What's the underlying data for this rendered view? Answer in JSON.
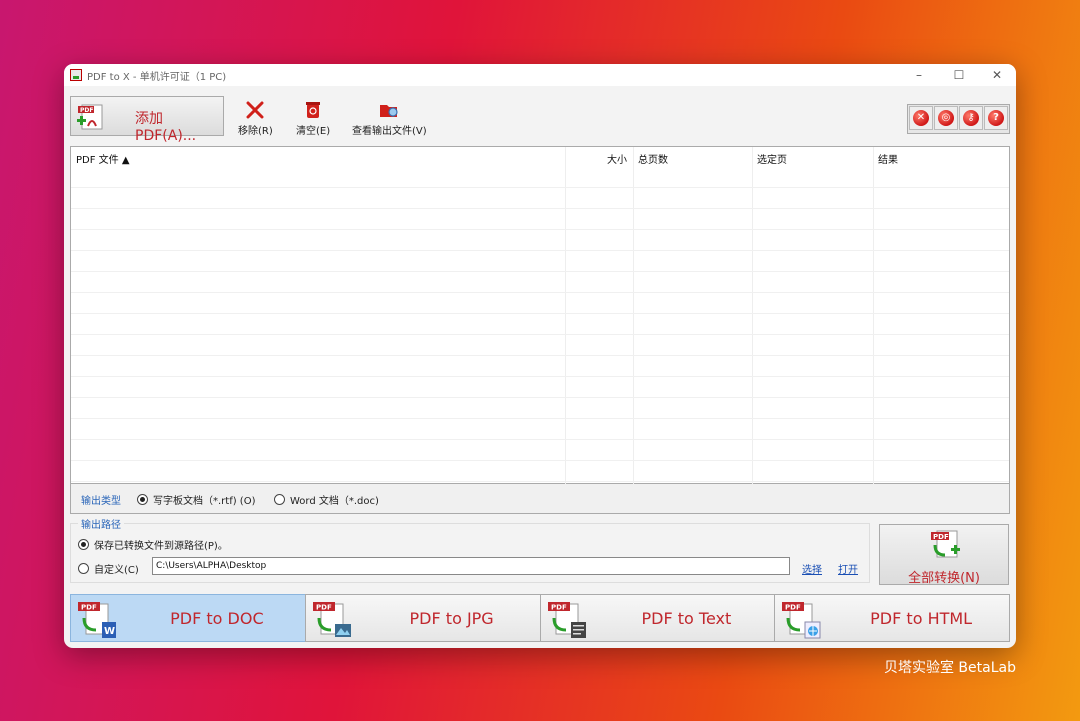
{
  "window": {
    "title": "PDF to X - 单机许可证（1 PC)",
    "controls": [
      "–",
      "☐",
      "✕"
    ]
  },
  "toolbar": {
    "add_label": "添加 PDF(A)...",
    "remove_label": "移除(R)",
    "clear_label": "清空(E)",
    "view_output_label": "查看输出文件(V)",
    "round_icons": [
      "close-circle-icon",
      "globe-icon",
      "key-icon",
      "help-icon"
    ],
    "round_glyphs": [
      "✕",
      "◎",
      "⚷",
      "?"
    ]
  },
  "file_list": {
    "columns": [
      "PDF 文件 ▲",
      "大小",
      "总页数",
      "选定页",
      "结果"
    ],
    "rows": []
  },
  "output_type": {
    "label": "输出类型",
    "options": [
      {
        "label": "写字板文档（*.rtf)  (O)",
        "selected": true
      },
      {
        "label": "Word 文档（*.doc)",
        "selected": false
      }
    ]
  },
  "output_path": {
    "title": "输出路径",
    "option_source": "保存已转换文件到源路径(P)。",
    "option_custom": "自定义(C)",
    "source_selected": true,
    "path_value": "C:\\Users\\ALPHA\\Desktop",
    "select_link": "选择",
    "open_link": "打开"
  },
  "convert_all_label": "全部转换(N)",
  "tabs": [
    {
      "label": "PDF to DOC",
      "active": true
    },
    {
      "label": "PDF to JPG",
      "active": false
    },
    {
      "label": "PDF to Text",
      "active": false
    },
    {
      "label": "PDF to HTML",
      "active": false
    }
  ],
  "watermark": "贝塔实验室 BetaLab",
  "colors": {
    "accent_red": "#c0272d",
    "link_blue": "#1a4fb4",
    "active_tab": "#bcd9f4"
  }
}
